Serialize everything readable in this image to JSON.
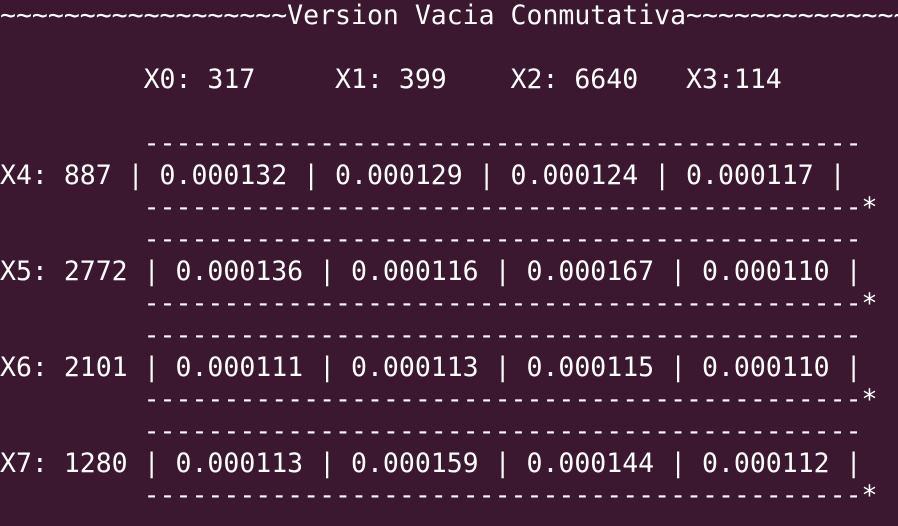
{
  "terminal": {
    "lines": [
      "~~~~~~~~~~~~~~~~~~Version Vacia Conmutativa~~~~~~~~~~~~~~~~~~~",
      "         X0: 317     X1: 399    X2: 6640   X3:114",
      "         ---------------------------------------------",
      "X4: 887 | 0.000132 | 0.000129 | 0.000124 | 0.000117 |",
      "         ---------------------------------------------*",
      "         ---------------------------------------------",
      "X5: 2772 | 0.000136 | 0.000116 | 0.000167 | 0.000110 |",
      "         ---------------------------------------------*",
      "         ---------------------------------------------",
      "X6: 2101 | 0.000111 | 0.000113 | 0.000115 | 0.000110 |",
      "         ---------------------------------------------*",
      "         ---------------------------------------------",
      "X7: 1280 | 0.000113 | 0.000159 | 0.000144 | 0.000112 |",
      "         ---------------------------------------------*"
    ]
  }
}
